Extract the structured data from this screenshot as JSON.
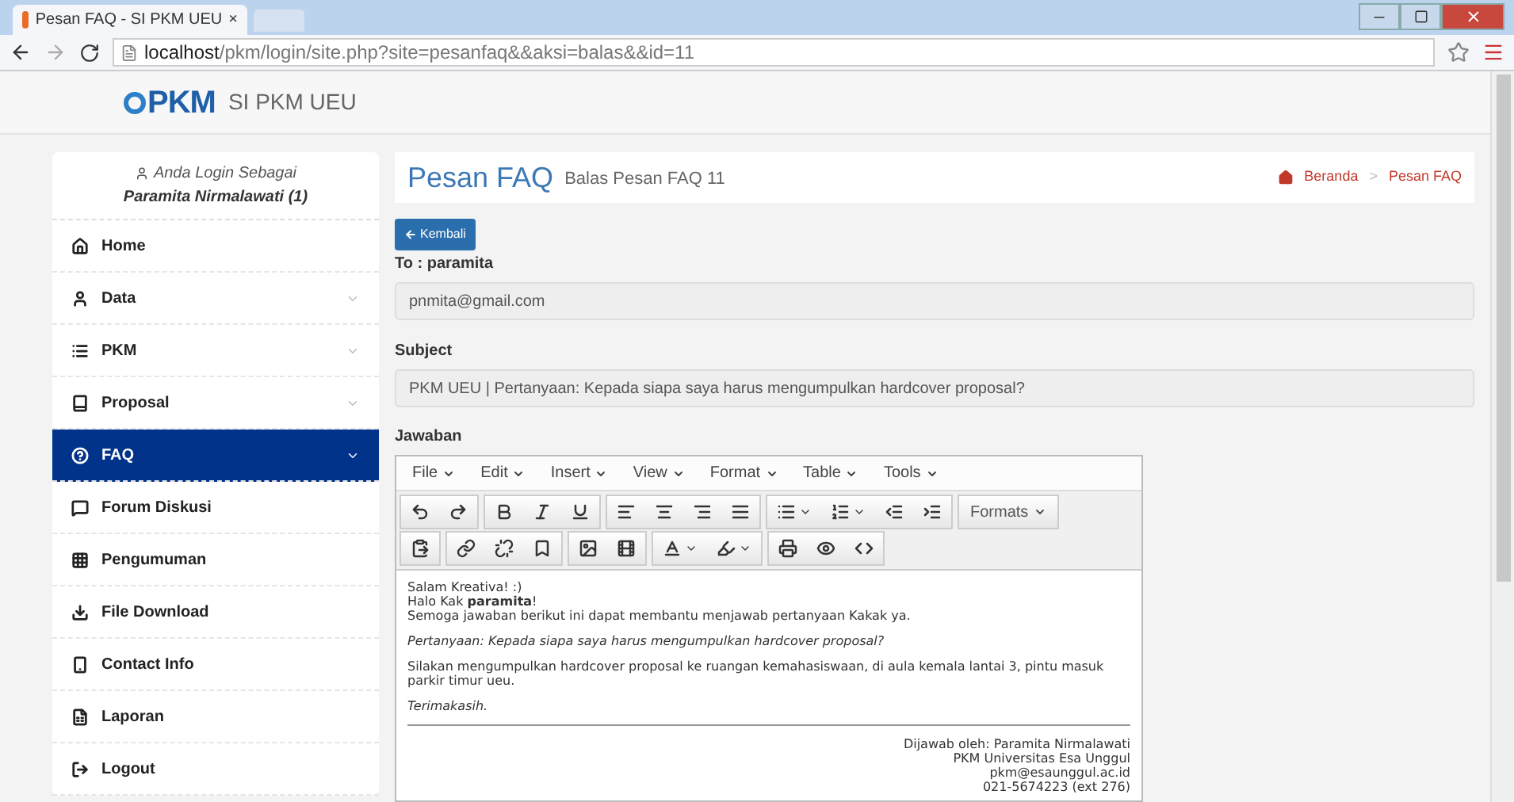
{
  "browser": {
    "tab_title": "Pesan FAQ - SI PKM UEU",
    "tab_close": "×",
    "url_host": "localhost",
    "url_path": "/pkm/login/site.php?site=pesanfaq&&aksi=balas&&id=11"
  },
  "header": {
    "logo_text": "PKM",
    "site_name": "SI PKM UEU"
  },
  "sidebar": {
    "login_label": "Anda Login Sebagai",
    "user_name": "Paramita Nirmalawati (1)",
    "items": [
      {
        "label": "Home",
        "selected": false,
        "has_submenu": false
      },
      {
        "label": "Data",
        "selected": false,
        "has_submenu": true
      },
      {
        "label": "PKM",
        "selected": false,
        "has_submenu": true
      },
      {
        "label": "Proposal",
        "selected": false,
        "has_submenu": true
      },
      {
        "label": "FAQ",
        "selected": true,
        "has_submenu": true
      },
      {
        "label": "Forum Diskusi",
        "selected": false,
        "has_submenu": false
      },
      {
        "label": "Pengumuman",
        "selected": false,
        "has_submenu": false
      },
      {
        "label": "File Download",
        "selected": false,
        "has_submenu": false
      },
      {
        "label": "Contact Info",
        "selected": false,
        "has_submenu": false
      },
      {
        "label": "Laporan",
        "selected": false,
        "has_submenu": false
      },
      {
        "label": "Logout",
        "selected": false,
        "has_submenu": false
      }
    ]
  },
  "page": {
    "title": "Pesan FAQ",
    "subtitle": "Balas Pesan FAQ 11",
    "breadcrumb": [
      "Beranda",
      "Pesan FAQ"
    ],
    "breadcrumb_separator": ">"
  },
  "back_button": "Kembali",
  "form": {
    "to_label": "To : paramita",
    "to_value": "pnmita@gmail.com",
    "subject_label": "Subject",
    "subject_value": "PKM UEU | Pertanyaan: Kepada siapa saya harus mengumpulkan hardcover proposal?",
    "answer_label": "Jawaban"
  },
  "editor": {
    "menus": [
      "File",
      "Edit",
      "Insert",
      "View",
      "Format",
      "Table",
      "Tools"
    ],
    "formats_button": "Formats",
    "content": [
      {
        "kind": "lines",
        "lines": [
          "Salam Kreativa! :)",
          "Halo Kak **paramita**!",
          "Semoga jawaban berikut ini dapat membantu menjawab pertanyaan Kakak ya."
        ]
      },
      {
        "kind": "italic",
        "lines": [
          "Pertanyaan: Kepada siapa saya harus mengumpulkan hardcover proposal?"
        ]
      },
      {
        "kind": "lines",
        "lines": [
          "Silakan mengumpulkan hardcover proposal ke ruangan kemahasiswaan, di aula kemala lantai 3, pintu masuk parkir timur ueu."
        ]
      },
      {
        "kind": "italic",
        "lines": [
          "Terimakasih."
        ]
      },
      {
        "kind": "rule"
      },
      {
        "kind": "signature",
        "lines": [
          "Dijawab oleh: Paramita Nirmalawati",
          "PKM Universitas Esa Unggul",
          "pkm@esaunggul.ac.id",
          "021-5674223 (ext 276)"
        ]
      }
    ]
  }
}
